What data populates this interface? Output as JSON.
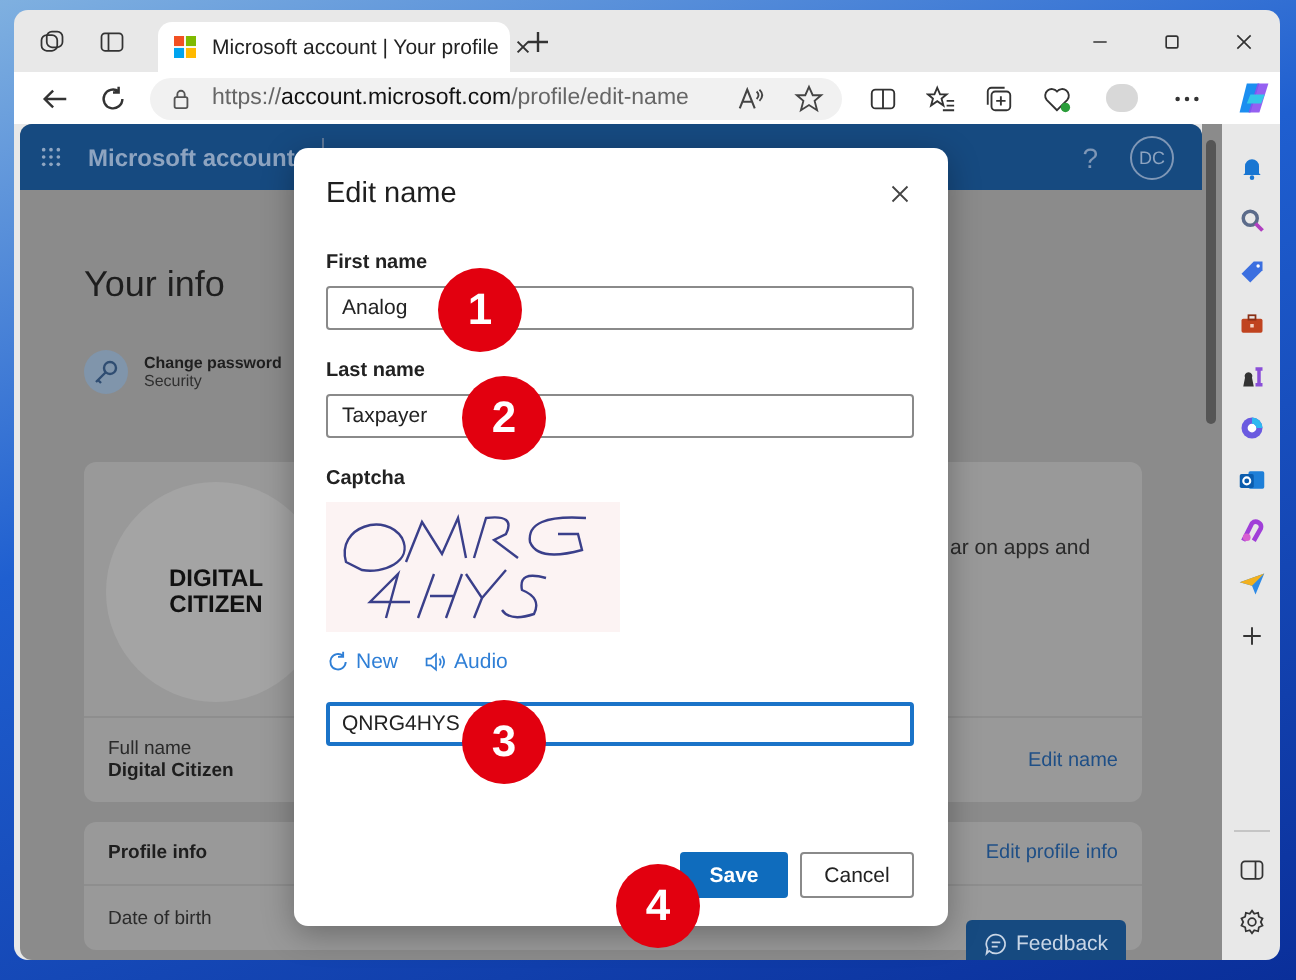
{
  "browser": {
    "tabs": [
      {
        "title": "Microsoft account | Your profile",
        "selected": true
      }
    ],
    "url": {
      "scheme": "https://",
      "host": "account.microsoft.com",
      "path": "/profile/edit-name"
    }
  },
  "nav": {
    "brand": "Microsoft account",
    "help": "?",
    "avatar": "DC"
  },
  "page": {
    "title": "Your info",
    "shortcut": {
      "label": "Change password",
      "sub": "Security"
    },
    "profile": {
      "logo_lines": [
        "DIGITAL",
        "CITIZEN"
      ],
      "partial_text": "ar on apps and",
      "name_label": "Full name",
      "name": "Digital Citizen",
      "edit": "Edit name"
    },
    "profile_info": {
      "title": "Profile info",
      "edit": "Edit profile info",
      "dob_label": "Date of birth"
    },
    "feedback": "Feedback"
  },
  "dialog": {
    "title": "Edit name",
    "fields": [
      {
        "label": "First name",
        "value": "Analog",
        "focused": false
      },
      {
        "label": "Last name",
        "value": "Taxpayer",
        "focused": false
      }
    ],
    "captcha": {
      "label": "Captcha",
      "new": "New",
      "audio": "Audio",
      "value": "QNRG4HYS",
      "focused": true
    },
    "buttons": [
      {
        "label": "Save",
        "kind": "primary"
      },
      {
        "label": "Cancel",
        "kind": "secondary"
      }
    ]
  },
  "callouts": [
    "1",
    "2",
    "3",
    "4"
  ]
}
